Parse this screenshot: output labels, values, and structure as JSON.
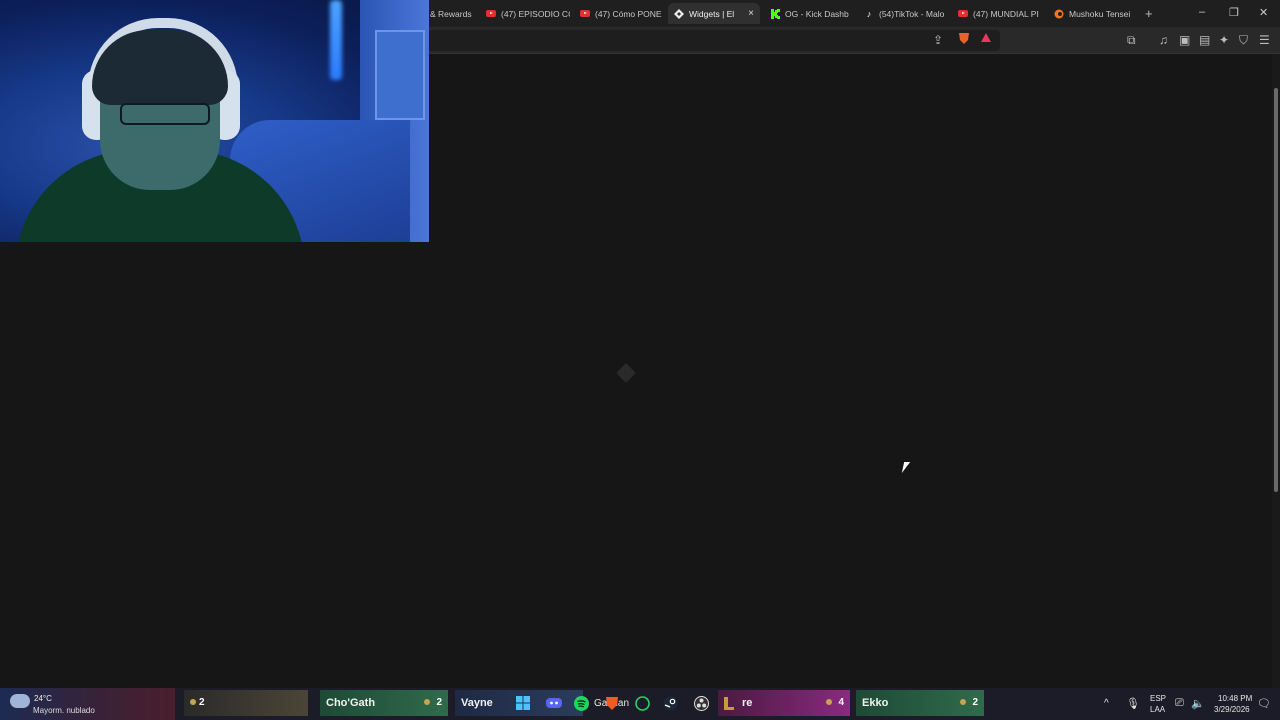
{
  "browser": {
    "tabs": [
      {
        "label": "& Rewards",
        "favicon": "none"
      },
      {
        "label": "(47) EPISODIO CC",
        "favicon": "youtube-icon"
      },
      {
        "label": "(47) Cómo PONE",
        "favicon": "youtube-icon"
      },
      {
        "label": "Widgets | El",
        "favicon": "widgets-icon",
        "active": true
      },
      {
        "label": "OG - Kick Dashb",
        "favicon": "kick-icon"
      },
      {
        "label": "(54)TikTok - Malo",
        "favicon": "tiktok-icon"
      },
      {
        "label": "(47) MUNDIAL PI",
        "favicon": "youtube-icon"
      },
      {
        "label": "Mushoku Tensei",
        "favicon": "crunchyroll-icon"
      }
    ],
    "tab_close": "×",
    "new_tab": "+",
    "window_controls": {
      "minimize": "–",
      "restore": "❐",
      "close": "✕"
    }
  },
  "taskbar": {
    "weather": {
      "temp": "24°C",
      "desc": "Mayorm. nublado"
    },
    "champions": [
      {
        "name": "",
        "count": "2"
      },
      {
        "name": "Cho'Gath",
        "count": "2"
      },
      {
        "name": "Vayne",
        "count": ""
      },
      {
        "name": "re",
        "count": "4"
      },
      {
        "name": "Ekko",
        "count": "2"
      }
    ],
    "overlay_text": "Ga plan",
    "tray": {
      "lang_top": "ESP",
      "lang_bottom": "LAA",
      "time": "10:48 PM",
      "date": "3/29/2026"
    }
  },
  "colors": {
    "background": "#161616",
    "tabbar": "#1f1f1f",
    "toolbar": "#292929"
  }
}
